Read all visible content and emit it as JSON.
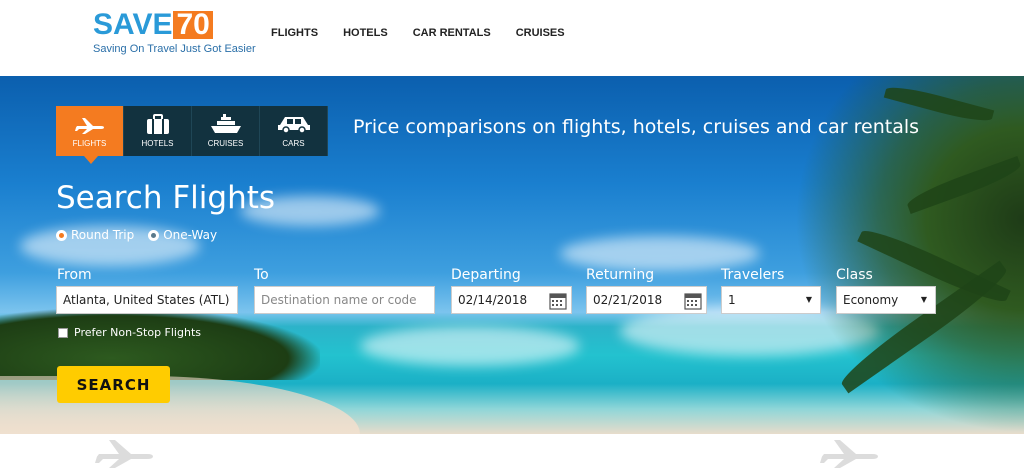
{
  "logo": {
    "word": "SAVE",
    "number": "70",
    "tagline": "Saving On Travel Just Got Easier"
  },
  "nav": [
    {
      "label": "FLIGHTS"
    },
    {
      "label": "HOTELS"
    },
    {
      "label": "CAR RENTALS"
    },
    {
      "label": "CRUISES"
    }
  ],
  "tabs": [
    {
      "label": "FLIGHTS",
      "icon": "plane-icon",
      "active": true
    },
    {
      "label": "HOTELS",
      "icon": "suitcase-icon",
      "active": false
    },
    {
      "label": "CRUISES",
      "icon": "ship-icon",
      "active": false
    },
    {
      "label": "CARS",
      "icon": "car-icon",
      "active": false
    }
  ],
  "tagline": "Price comparisons on flights, hotels, cruises and car rentals",
  "form": {
    "title": "Search Flights",
    "trip_types": [
      {
        "label": "Round Trip",
        "selected": true
      },
      {
        "label": "One-Way",
        "selected": false
      }
    ],
    "from": {
      "label": "From",
      "value": "Atlanta, United States (ATL)"
    },
    "to": {
      "label": "To",
      "placeholder": "Destination name or code",
      "value": ""
    },
    "departing": {
      "label": "Departing",
      "value": "02/14/2018"
    },
    "returning": {
      "label": "Returning",
      "value": "02/21/2018"
    },
    "travelers": {
      "label": "Travelers",
      "value": "1"
    },
    "class": {
      "label": "Class",
      "value": "Economy"
    },
    "nonstop": {
      "label": "Prefer Non-Stop Flights",
      "checked": false
    },
    "search_label": "SEARCH"
  },
  "colors": {
    "accent": "#f47b20",
    "brand_blue": "#2a9ad8",
    "tab_dark": "#12323f",
    "button": "#ffcc00"
  }
}
